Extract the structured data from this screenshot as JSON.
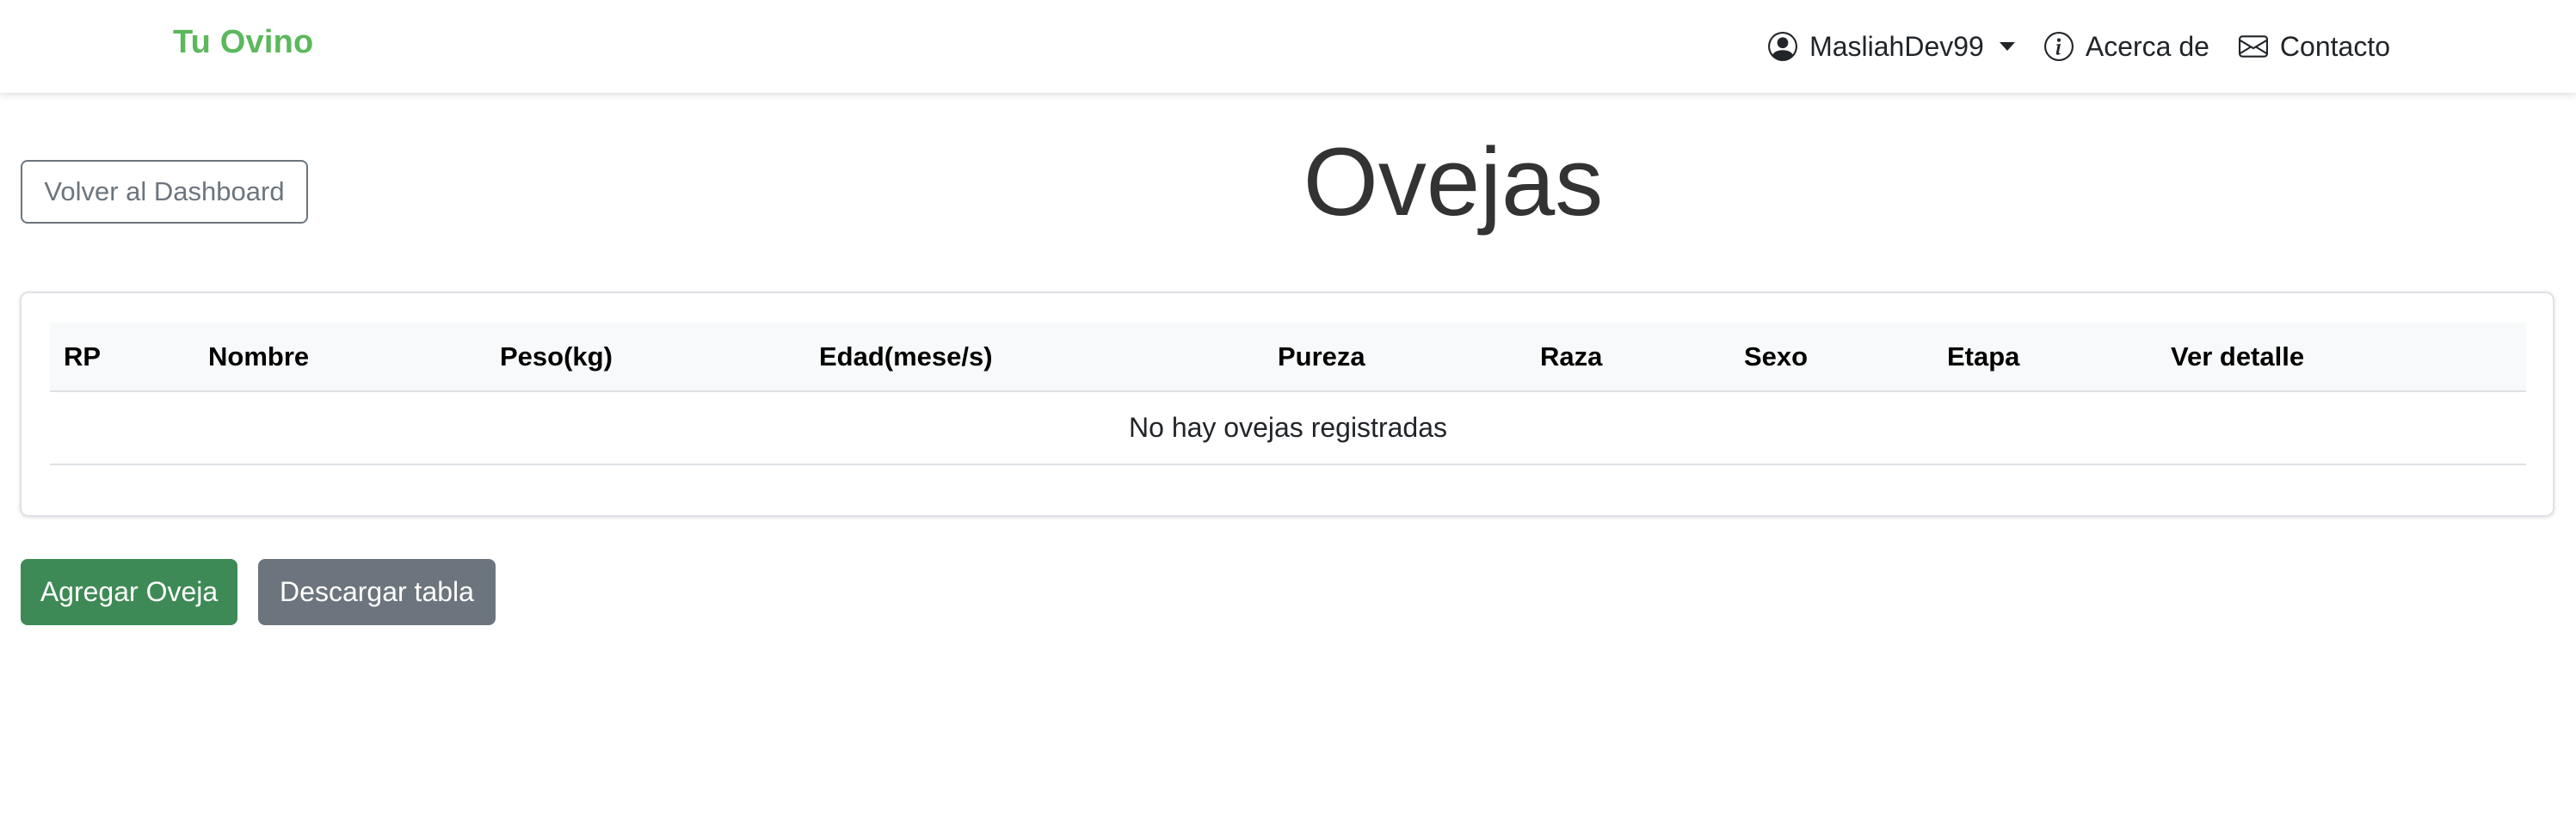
{
  "navbar": {
    "brand": "Tu Ovino",
    "user_label": "MasliahDev99",
    "about_label": "Acerca de",
    "contact_label": "Contacto",
    "brand_color": "#5cb85c"
  },
  "actions": {
    "back_label": "Volver al Dashboard",
    "add_label": "Agregar Oveja",
    "download_label": "Descargar tabla"
  },
  "page": {
    "title": "Ovejas"
  },
  "table": {
    "columns": [
      "RP",
      "Nombre",
      "Peso(kg)",
      "Edad(mese/s)",
      "Pureza",
      "Raza",
      "Sexo",
      "Etapa",
      "Ver detalle"
    ],
    "empty_message": "No hay ovejas registradas"
  },
  "icons": {
    "user": "person-circle-icon",
    "about": "info-circle-icon",
    "contact": "envelope-icon",
    "dropdown": "caret-down-icon"
  },
  "colors": {
    "primary_button": "#3e8a56",
    "secondary_button": "#6c757d"
  }
}
